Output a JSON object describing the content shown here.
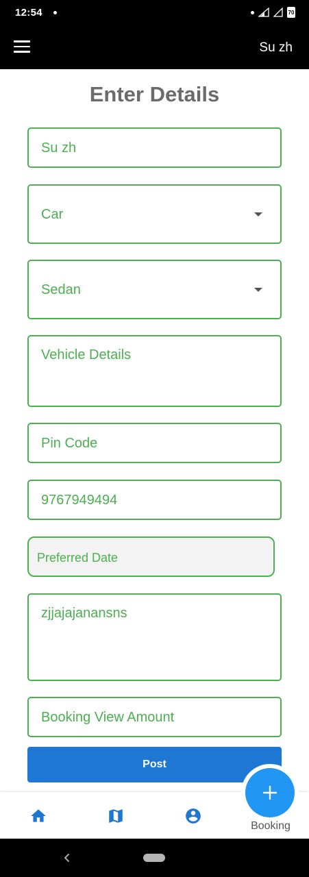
{
  "status_bar": {
    "time": "12:54",
    "battery": "70"
  },
  "app_bar": {
    "user_name": "Su zh",
    "menu_icon": "hamburger-menu-icon"
  },
  "page_title": "Enter Details",
  "form": {
    "name_value": "Su zh",
    "vehicle_type_value": "Car",
    "vehicle_class_value": "Sedan",
    "vehicle_details_placeholder": "Vehicle Details",
    "pin_code_placeholder": "Pin Code",
    "phone_value": "9767949494",
    "preferred_date_placeholder": "Preferred Date",
    "notes_value": "zjjajajanansns",
    "booking_amount_placeholder": "Booking View Amount",
    "post_label": "Post"
  },
  "bottom_nav": {
    "items": [
      {
        "icon": "home-icon"
      },
      {
        "icon": "map-icon"
      },
      {
        "icon": "account-circle-icon"
      }
    ],
    "fab_icon": "plus-icon",
    "fab_label": "Booking"
  },
  "colors": {
    "accent_green": "#4caf50",
    "button_blue": "#1e77d3",
    "fab_blue": "#2196f3",
    "nav_icon_blue": "#1e77d3"
  }
}
